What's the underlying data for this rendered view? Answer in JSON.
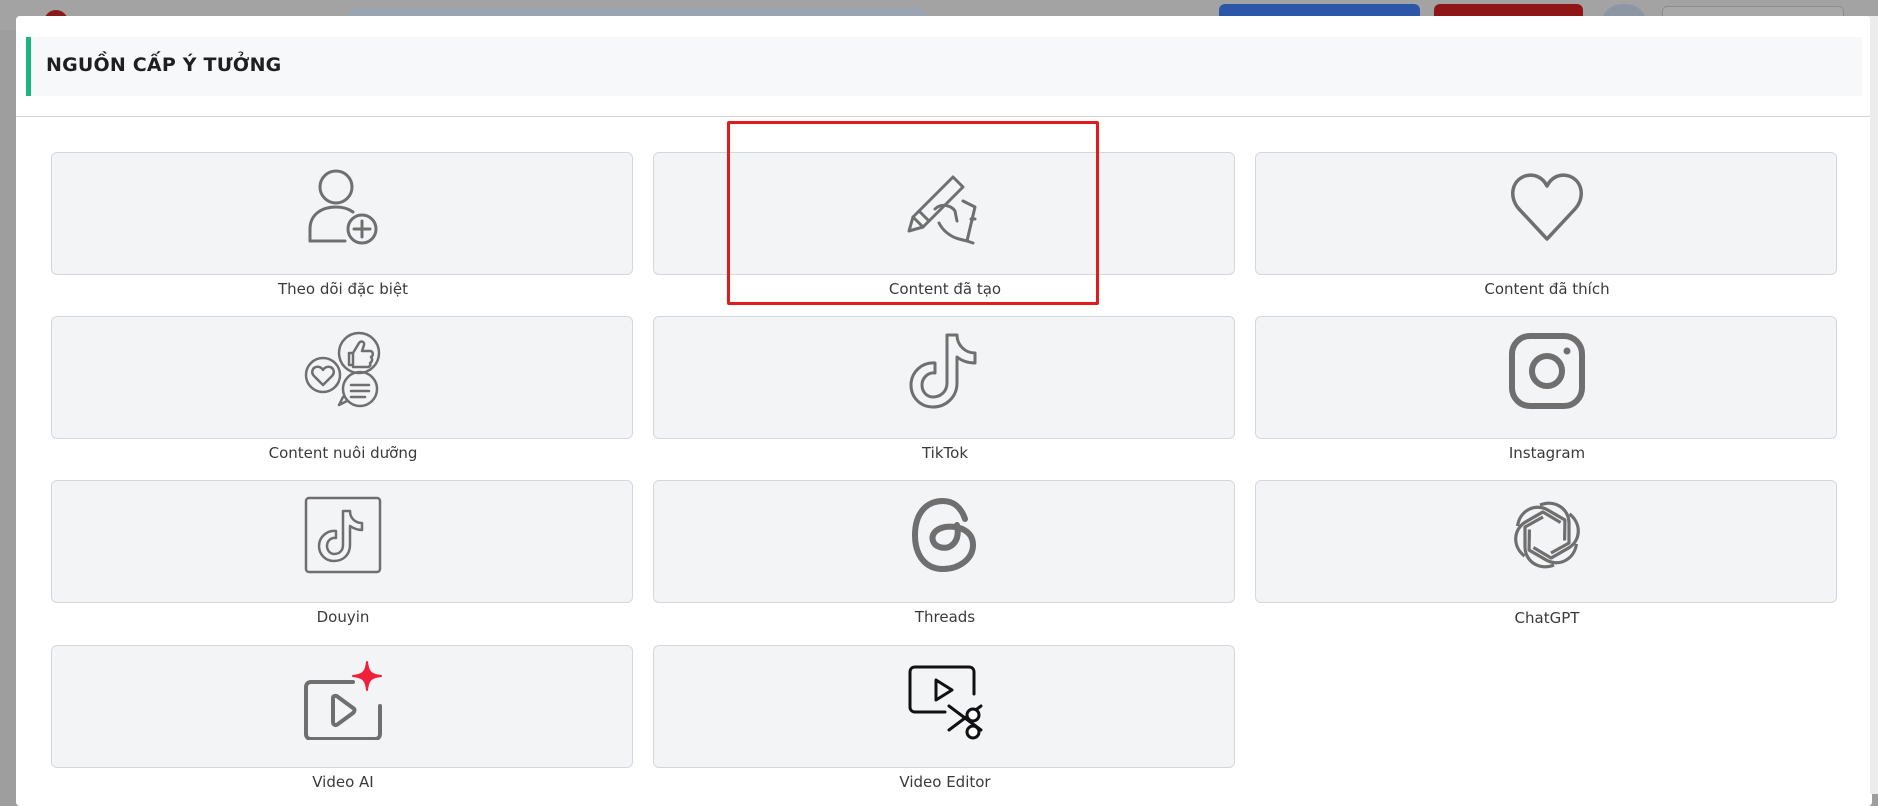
{
  "modal": {
    "title": "NGUỒN CẤP Ý TƯỞNG"
  },
  "sources": [
    {
      "label": "Theo dõi đặc biệt",
      "icon": "user-add-icon"
    },
    {
      "label": "Content đã tạo",
      "icon": "hand-writing-icon"
    },
    {
      "label": "Content đã thích",
      "icon": "heart-icon"
    },
    {
      "label": "Content nuôi dưỡng",
      "icon": "engagement-icon"
    },
    {
      "label": "TikTok",
      "icon": "tiktok-icon"
    },
    {
      "label": "Instagram",
      "icon": "instagram-icon"
    },
    {
      "label": "Douyin",
      "icon": "douyin-icon"
    },
    {
      "label": "Threads",
      "icon": "threads-icon"
    },
    {
      "label": "ChatGPT",
      "icon": "chatgpt-icon"
    },
    {
      "label": "Video AI",
      "icon": "video-ai-icon"
    },
    {
      "label": "Video Editor",
      "icon": "video-editor-icon"
    }
  ],
  "colors": {
    "accent": "#1bb584",
    "highlight": "#e11b1b",
    "icon": "#6f6f6f",
    "sparkle": "#f0203a"
  }
}
